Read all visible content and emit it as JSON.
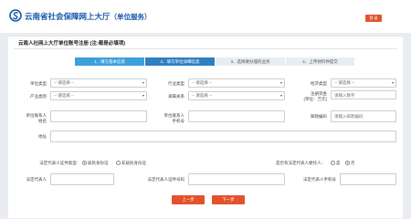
{
  "header": {
    "title": "云南省社会保障网上大厅",
    "subtitle": "（单位服务）",
    "login_label": "登 录"
  },
  "form": {
    "title": "云南人社网上大厅单位账号注册 (注:都是必填项)"
  },
  "steps": [
    {
      "label": "1、填写基本信息",
      "state": "done"
    },
    {
      "label": "2、填写单位详细信息",
      "state": "active"
    },
    {
      "label": "3、选择要办理的业务",
      "state": "todo"
    },
    {
      "label": "4、上传材料件提交",
      "state": "todo"
    }
  ],
  "fields": {
    "unit_type": {
      "label": "单位类型",
      "value": "-- 请选择 --"
    },
    "industry_type": {
      "label": "行业类型",
      "value": "-- 请选择 --"
    },
    "economic_type": {
      "label": "经济类型",
      "value": "-- 请选择 --"
    },
    "industry_category": {
      "label": "产业类别",
      "value": "-- 请选择 --"
    },
    "affiliation": {
      "label": "隶属关系",
      "value": "-- 请选择 --"
    },
    "registered_capital": {
      "label": "注册资金",
      "unit": "(单位：万元)",
      "placeholder": "请输入数字"
    },
    "contact_name": {
      "label": "单位联系人",
      "label2": "姓名",
      "value": ""
    },
    "contact_phone": {
      "label": "单位联系人",
      "label2": "手机号",
      "value": ""
    },
    "postal_code": {
      "label": "邮政编码",
      "placeholder": "请输入邮政编码"
    },
    "address": {
      "label": "地址",
      "value": ""
    },
    "legal_id_type": {
      "label": "法定代表人证件类型:",
      "options": [
        "居民身份证",
        "非居民身份证"
      ],
      "selected": 0
    },
    "is_legal_agent": {
      "label": "是否有法定代表人委托人：",
      "options": [
        "是",
        "否"
      ],
      "selected": 1
    },
    "legal_name": {
      "label": "法定代表人",
      "value": ""
    },
    "legal_id_number": {
      "label": "法定代表人证件号码",
      "value": ""
    },
    "legal_phone": {
      "label": "法定代表人手机号",
      "value": ""
    }
  },
  "buttons": {
    "prev": "上一步",
    "next": "下一步"
  },
  "colors": {
    "brand": "#1a5aa8",
    "accent": "#e2532d",
    "step_done": "#3ba0dc",
    "step_active": "#2f7fc1"
  }
}
